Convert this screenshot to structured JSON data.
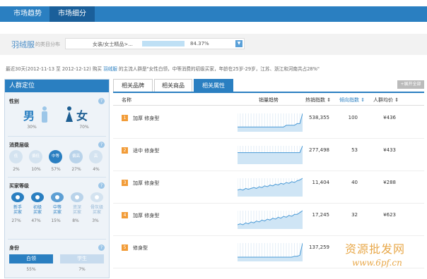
{
  "tabs": [
    "市场趋势",
    "市场细分"
  ],
  "category": {
    "name": "羽绒服",
    "sub": "的类目分布",
    "path": "女装/女士精品>...",
    "percent": 0.8437,
    "percent_label": "84.37%"
  },
  "summary": {
    "prefix": "最近30天(2012-11-13 至 2012-12-12) 购买",
    "cat": "羽绒服",
    "suffix": "的主流人群是\"女性白领，中等消费的初级买家，年龄在25岁-29岁，江苏、浙江和河南共占28%\""
  },
  "left": {
    "title": "人群定位",
    "help_mark": "?",
    "gender": {
      "title": "性别",
      "male": {
        "label": "男",
        "pct": "30%"
      },
      "female": {
        "label": "女",
        "pct": "70%"
      }
    },
    "spend": {
      "title": "消费层级",
      "items": [
        {
          "label": "低",
          "pct": "2%",
          "on": false
        },
        {
          "label": "偏低",
          "pct": "10%",
          "on": false
        },
        {
          "label": "中等",
          "pct": "57%",
          "on": true
        },
        {
          "label": "偏高",
          "pct": "27%",
          "on": false
        },
        {
          "label": "高",
          "pct": "4%",
          "on": false
        }
      ]
    },
    "buyer": {
      "title": "买家等级",
      "items": [
        {
          "l1": "新手",
          "l2": "买家",
          "pct": "27%"
        },
        {
          "l1": "初级",
          "l2": "买家",
          "pct": "47%"
        },
        {
          "l1": "中等",
          "l2": "买家",
          "pct": "15%"
        },
        {
          "l1": "资深",
          "l2": "买家",
          "pct": "8%"
        },
        {
          "l1": "骨灰级",
          "l2": "买家",
          "pct": "3%"
        }
      ]
    },
    "identity": {
      "title": "身份",
      "items": [
        {
          "label": "白领",
          "pct": "55%"
        },
        {
          "label": "学生",
          "pct": "7%"
        }
      ]
    }
  },
  "right": {
    "tabs": [
      "相关品牌",
      "相关商品",
      "相关属性"
    ],
    "export_label": "+展开全部",
    "headers": {
      "name": "名称",
      "trend": "销量趋势",
      "hot": "热销指数 ⇕",
      "tend": "倾向指数 ⇕",
      "price": "人群均价 ⇕"
    },
    "rows": [
      {
        "rank": "1",
        "name": "加厚 修身型",
        "hot": "538,355",
        "tend": "100",
        "price": "¥436",
        "spark": [
          2,
          2,
          2,
          2,
          2,
          2,
          2,
          2,
          2,
          2,
          2,
          2,
          2,
          2,
          2,
          2,
          2,
          2,
          3,
          3,
          3,
          3,
          4,
          4,
          10
        ]
      },
      {
        "rank": "2",
        "name": "适中 修身型",
        "hot": "277,498",
        "tend": "53",
        "price": "¥433",
        "spark": [
          18,
          18,
          18,
          18,
          18,
          18,
          18,
          18,
          18,
          18,
          18,
          18,
          18,
          18,
          18,
          18,
          18,
          18,
          18,
          18,
          18,
          18,
          18,
          18,
          30
        ]
      },
      {
        "rank": "3",
        "name": "加厚 修身型",
        "hot": "11,404",
        "tend": "40",
        "price": "¥288",
        "spark": [
          6,
          7,
          6,
          8,
          7,
          8,
          9,
          8,
          10,
          9,
          11,
          10,
          12,
          11,
          13,
          12,
          14,
          13,
          15,
          14,
          16,
          15,
          17,
          18,
          20
        ]
      },
      {
        "rank": "4",
        "name": "加厚 修身型",
        "hot": "17,245",
        "tend": "32",
        "price": "¥623",
        "spark": [
          3,
          4,
          3,
          5,
          4,
          6,
          5,
          7,
          6,
          8,
          7,
          9,
          8,
          10,
          9,
          11,
          10,
          12,
          11,
          13,
          12,
          14,
          14,
          16,
          18
        ]
      },
      {
        "rank": "5",
        "name": "修身型",
        "hot": "137,259",
        "tend": "",
        "price": "",
        "spark": [
          3,
          3,
          3,
          3,
          3,
          3,
          3,
          3,
          3,
          3,
          3,
          3,
          3,
          3,
          3,
          3,
          3,
          3,
          3,
          3,
          3,
          4,
          4,
          5,
          18
        ]
      }
    ]
  },
  "watermark": {
    "line1": "资源批发网",
    "line2": "www.6pf.cn"
  }
}
